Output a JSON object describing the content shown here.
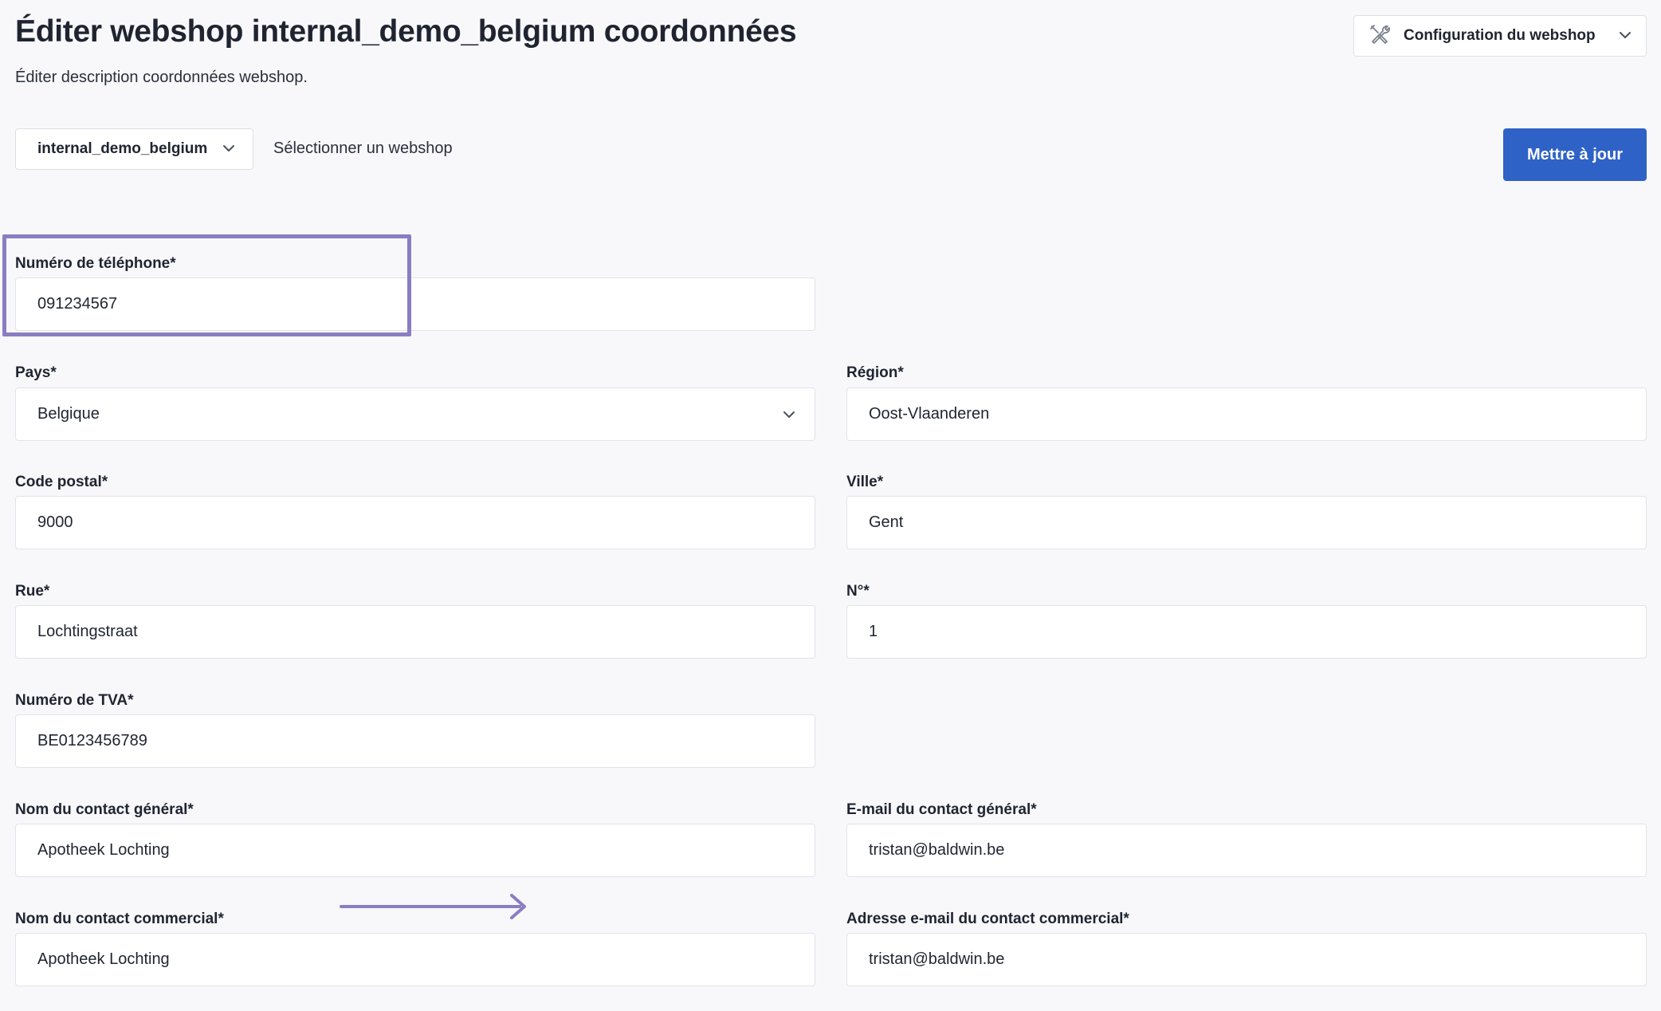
{
  "header": {
    "title": "Éditer webshop internal_demo_belgium coordonnées",
    "subtitle": "Éditer description coordonnées webshop.",
    "config_label": "Configuration du webshop"
  },
  "toolbar": {
    "webshop_selected": "internal_demo_belgium",
    "webshop_hint": "Sélectionner un webshop",
    "update_label": "Mettre à jour"
  },
  "form": {
    "phone": {
      "label": "Numéro de téléphone*",
      "value": "091234567"
    },
    "country": {
      "label": "Pays*",
      "value": "Belgique"
    },
    "region": {
      "label": "Région*",
      "value": "Oost-Vlaanderen"
    },
    "postal_code": {
      "label": "Code postal*",
      "value": "9000"
    },
    "city": {
      "label": "Ville*",
      "value": "Gent"
    },
    "street": {
      "label": "Rue*",
      "value": "Lochtingstraat"
    },
    "number": {
      "label": "N°*",
      "value": "1"
    },
    "vat": {
      "label": "Numéro de TVA*",
      "value": "BE0123456789"
    },
    "general_contact_name": {
      "label": "Nom du contact général*",
      "value": "Apotheek Lochting"
    },
    "general_contact_email": {
      "label": "E-mail du contact général*",
      "value": "tristan@baldwin.be"
    },
    "commercial_contact_name": {
      "label": "Nom du contact commercial*",
      "value": "Apotheek Lochting"
    },
    "commercial_contact_email": {
      "label": "Adresse e-mail du contact commercial*",
      "value": "tristan@baldwin.be"
    }
  },
  "colors": {
    "accent": "#2f62c7",
    "annotation": "#8a7dc2",
    "background": "#f8f8fb"
  }
}
